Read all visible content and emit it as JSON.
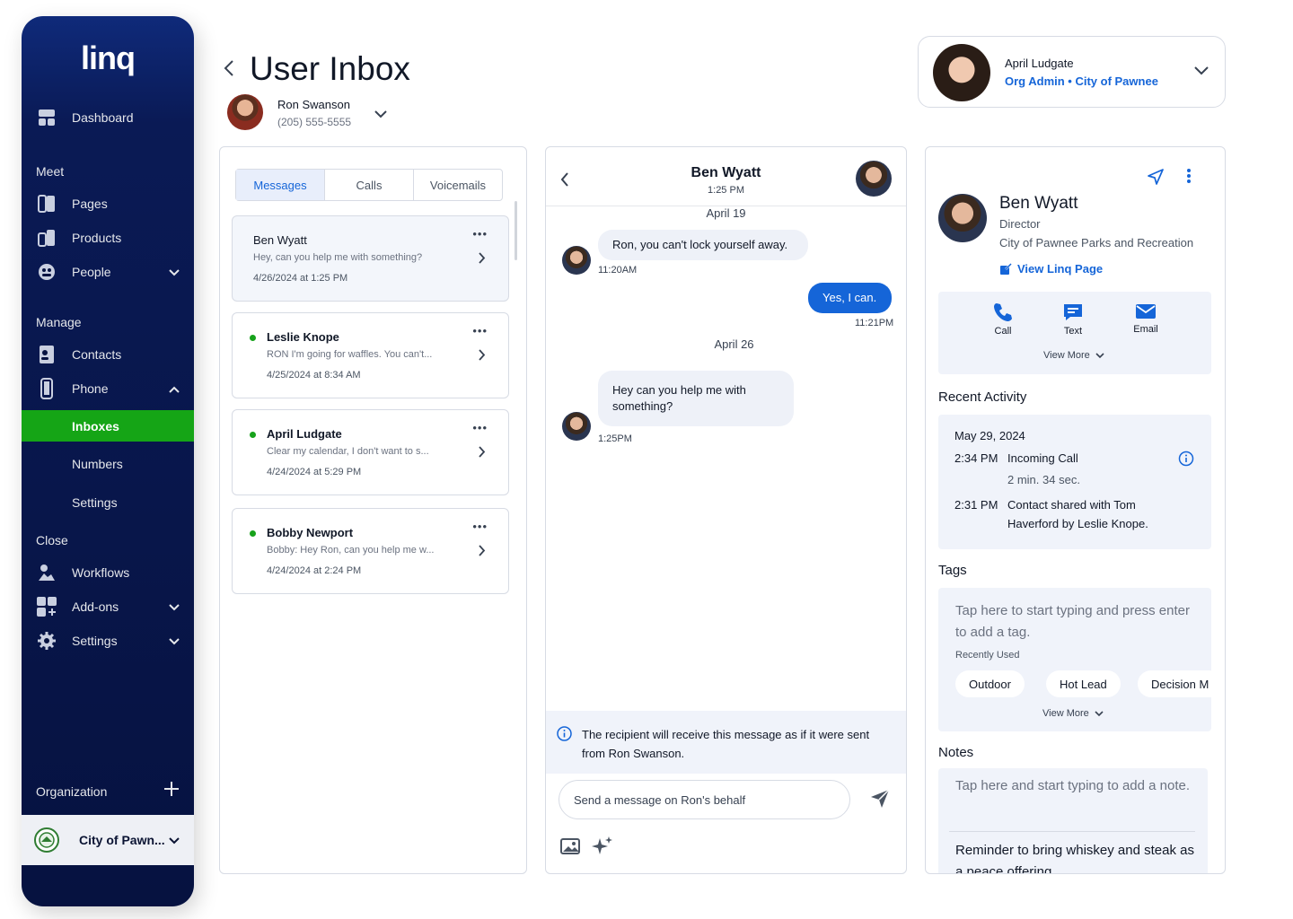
{
  "sidebar": {
    "logo": "linq",
    "dashboard": "Dashboard",
    "sections": {
      "meet": "Meet",
      "manage": "Manage",
      "close": "Close"
    },
    "meet_items": [
      "Pages",
      "Products",
      "People"
    ],
    "manage_items": [
      "Contacts",
      "Phone"
    ],
    "phone_sub": [
      "Inboxes",
      "Numbers",
      "Settings"
    ],
    "close_items": [
      "Workflows",
      "Add-ons",
      "Settings"
    ],
    "organization_label": "Organization",
    "org_name": "City of Pawn..."
  },
  "header": {
    "title": "User Inbox",
    "user_name": "Ron Swanson",
    "user_phone": "(205) 555-5555"
  },
  "account": {
    "name": "April Ludgate",
    "role": "Org Admin • City of Pawnee"
  },
  "list": {
    "tabs": [
      "Messages",
      "Calls",
      "Voicemails"
    ],
    "conversations": [
      {
        "name": "Ben Wyatt",
        "preview": "Hey, can you help me with something?",
        "date": "4/26/2024 at 1:25 PM",
        "unread": false
      },
      {
        "name": "Leslie Knope",
        "preview": "RON I'm going for waffles. You can't...",
        "date": "4/25/2024 at 8:34 AM",
        "unread": true
      },
      {
        "name": "April Ludgate",
        "preview": "Clear my calendar, I don't want to s...",
        "date": "4/24/2024 at 5:29 PM",
        "unread": true
      },
      {
        "name": "Bobby Newport",
        "preview": "Bobby: Hey Ron, can you help me w...",
        "date": "4/24/2024 at 2:24 PM",
        "unread": true
      }
    ],
    "more": "•••"
  },
  "chat": {
    "contact_name": "Ben Wyatt",
    "contact_time": "1:25 PM",
    "date1": "April 19",
    "msg1": "Ron, you can't lock yourself away.",
    "msg1_time": "11:20AM",
    "msg2": "Yes, I can.",
    "msg2_time": "11:21PM",
    "date2": "April 26",
    "msg3": "Hey can you help me with something?",
    "msg3_time": "1:25PM",
    "notice": "The recipient will receive this message as if it were sent from Ron Swanson.",
    "compose_placeholder": "Send a message on Ron's behalf"
  },
  "detail": {
    "name": "Ben Wyatt",
    "title": "Director",
    "org": "City of Pawnee Parks and Recreation",
    "link": "View Linq Page",
    "actions": [
      "Call",
      "Text",
      "Email"
    ],
    "view_more": "View More",
    "recent_activity_title": "Recent Activity",
    "activity_date": "May 29, 2024",
    "act1_time": "2:34 PM",
    "act1_text": "Incoming Call",
    "act1_sub": "2 min. 34 sec.",
    "act2_time": "2:31 PM",
    "act2_line1": "Contact shared with Tom",
    "act2_line2": "Haverford by Leslie Knope.",
    "tags_title": "Tags",
    "tags_placeholder": "Tap here to start typing and press enter to add a tag.",
    "recently_used": "Recently Used",
    "tags": [
      "Outdoor",
      "Hot Lead",
      "Decision M"
    ],
    "notes_title": "Notes",
    "notes_placeholder": "Tap here and start typing to add a note.",
    "note": "Reminder to bring whiskey and steak as a peace offering"
  },
  "colors": {
    "accent": "#1565d8",
    "active_nav": "#15a516",
    "sidebar": "#061240"
  }
}
